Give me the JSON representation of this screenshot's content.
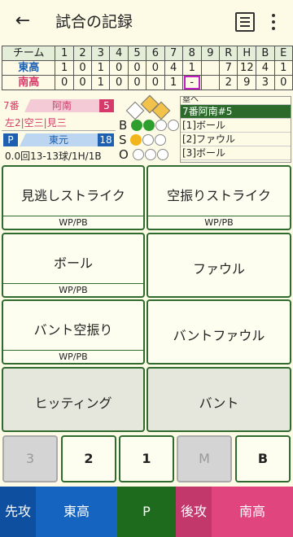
{
  "appbar": {
    "title": "試合の記録",
    "back_icon": "arrow-left-icon",
    "list_icon": "list-icon",
    "more_icon": "more-vert-icon"
  },
  "scoreboard": {
    "header": [
      "チーム",
      "1",
      "2",
      "3",
      "4",
      "5",
      "6",
      "7",
      "8",
      "9",
      "R",
      "H",
      "B",
      "E"
    ],
    "rows": [
      {
        "team": "東高",
        "innings": [
          "1",
          "0",
          "1",
          "0",
          "0",
          "0",
          "4",
          "1",
          ""
        ],
        "totals": [
          "7",
          "12",
          "4",
          "1"
        ]
      },
      {
        "team": "南高",
        "innings": [
          "0",
          "0",
          "1",
          "0",
          "0",
          "0",
          "1",
          "-",
          ""
        ],
        "totals": [
          "2",
          "9",
          "3",
          "0"
        ]
      }
    ]
  },
  "status": {
    "batter_order": "7番",
    "batter_name": "阿南",
    "batter_number": "5",
    "batter_record": "左2|空三|見三",
    "pitcher_tag": "P",
    "pitcher_name": "東元",
    "pitcher_number": "18",
    "pitcher_stats": "0.0回13-13球/1H/1B",
    "bso": {
      "b_label": "B",
      "s_label": "S",
      "o_label": "O",
      "balls": 2,
      "strikes": 1,
      "outs": 0
    }
  },
  "log": {
    "header": "塁へ",
    "items": [
      "7番阿南#5",
      "[1]ボール",
      "[2]ファウル",
      "[3]ボール"
    ],
    "selected": 0
  },
  "pitch_buttons": [
    {
      "label": "見逃しストライク",
      "sub": "WP/PB"
    },
    {
      "label": "空振りストライク",
      "sub": "WP/PB"
    },
    {
      "label": "ボール",
      "sub": "WP/PB"
    },
    {
      "label": "ファウル",
      "sub": ""
    },
    {
      "label": "バント空振り",
      "sub": "WP/PB"
    },
    {
      "label": "バントファウル",
      "sub": ""
    },
    {
      "label": "ヒッティング",
      "sub": ""
    },
    {
      "label": "バント",
      "sub": ""
    }
  ],
  "runner_buttons": [
    "3",
    "2",
    "1",
    "M",
    "B"
  ],
  "bottom": {
    "attack_label": "先攻",
    "attack_team": "東高",
    "pitcher_label": "P",
    "defend_label": "後攻",
    "defend_team": "南高"
  },
  "colors": {
    "top_team": "#1d5fb0",
    "bottom_team": "#d63a6a",
    "green": "#2f6b2f",
    "ball_green": "#2e9e2e",
    "strike_yellow": "#f2b51c"
  }
}
